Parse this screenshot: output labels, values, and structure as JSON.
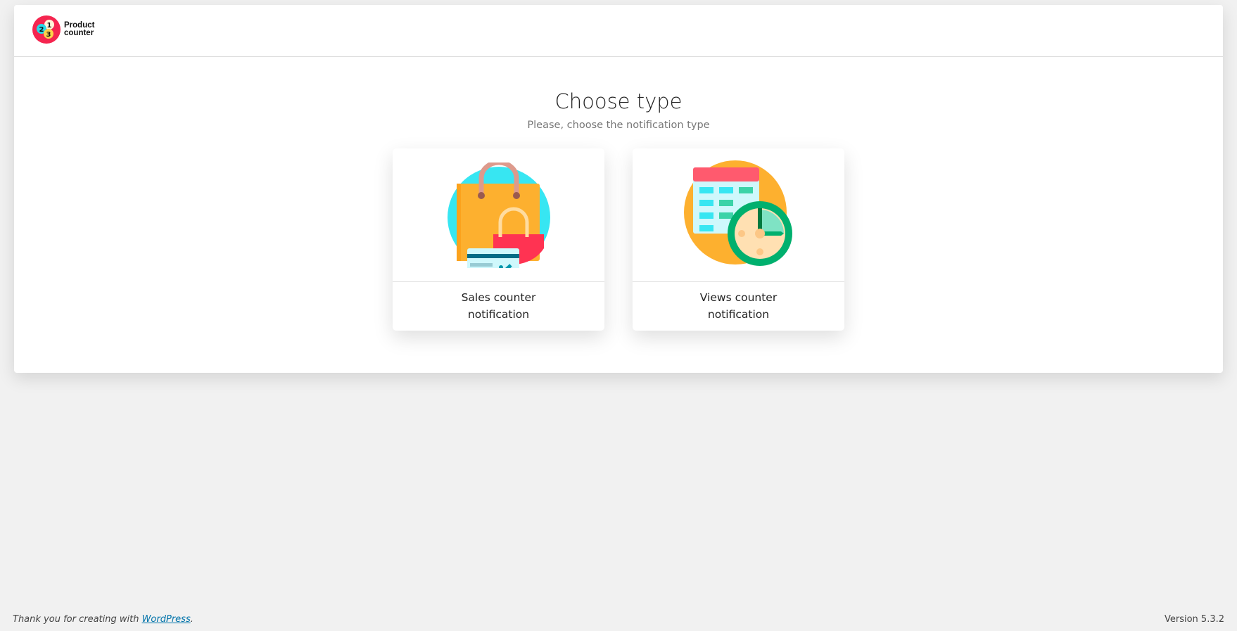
{
  "header": {
    "logo_line1": "Product",
    "logo_line2": "counter",
    "logo_numbers": [
      "1",
      "2",
      "3"
    ]
  },
  "main": {
    "title": "Choose type",
    "subtitle": "Please, choose the notification type",
    "cards": [
      {
        "line1": "Sales counter",
        "line2": "notification",
        "icon": "shopping-bags-icon"
      },
      {
        "line1": "Views counter",
        "line2": "notification",
        "icon": "calendar-clock-icon"
      }
    ]
  },
  "footer": {
    "thanks_prefix": "Thank you for creating with ",
    "link": "WordPress",
    "suffix": ".",
    "version": "Version 5.3.2"
  }
}
